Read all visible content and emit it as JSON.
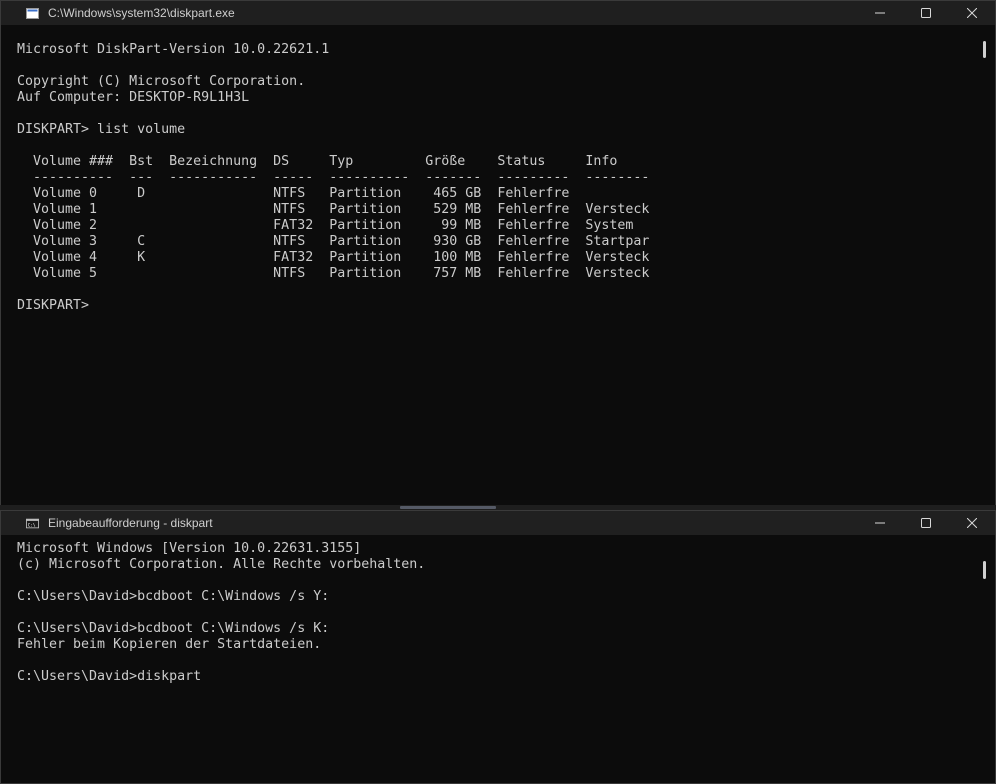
{
  "top_window": {
    "title": "C:\\Windows\\system32\\diskpart.exe",
    "icon": "console-window-icon",
    "lines": [
      "Microsoft DiskPart-Version 10.0.22621.1",
      "",
      "Copyright (C) Microsoft Corporation.",
      "Auf Computer: DESKTOP-R9L1H3L",
      "",
      "DISKPART> list volume",
      "",
      "  Volume ###  Bst  Bezeichnung  DS     Typ         Größe    Status     Info",
      "  ----------  ---  -----------  -----  ----------  -------  ---------  --------",
      "  Volume 0     D                NTFS   Partition    465 GB  Fehlerfre",
      "  Volume 1                      NTFS   Partition    529 MB  Fehlerfre  Versteck",
      "  Volume 2                      FAT32  Partition     99 MB  Fehlerfre  System",
      "  Volume 3     C                NTFS   Partition    930 GB  Fehlerfre  Startpar",
      "  Volume 4     K                FAT32  Partition    100 MB  Fehlerfre  Versteck",
      "  Volume 5                      NTFS   Partition    757 MB  Fehlerfre  Versteck",
      "",
      "DISKPART>"
    ]
  },
  "bottom_window": {
    "title": "Eingabeaufforderung - diskpart",
    "icon": "command-prompt-icon",
    "lines": [
      "Microsoft Windows [Version 10.0.22631.3155]",
      "(c) Microsoft Corporation. Alle Rechte vorbehalten.",
      "",
      "C:\\Users\\David>bcdboot C:\\Windows /s Y:",
      "",
      "C:\\Users\\David>bcdboot C:\\Windows /s K:",
      "Fehler beim Kopieren der Startdateien.",
      "",
      "C:\\Users\\David>diskpart"
    ]
  },
  "colors": {
    "console_bg": "#0c0c0c",
    "console_text": "#cccccc",
    "titlebar_bg": "#202020"
  }
}
